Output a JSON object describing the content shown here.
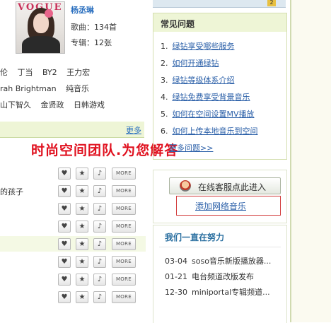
{
  "artist": {
    "name": "杨丞琳",
    "songs": "歌曲：134首",
    "albums": "专辑：12张",
    "photo_magazine_text": "VOGUE"
  },
  "related_artists": [
    [
      "伦",
      "丁当",
      "BY2",
      "王力宏"
    ],
    [
      "rah Brightman",
      "纯音乐"
    ],
    [
      "山下智久",
      "金贤政",
      "日韩游戏"
    ]
  ],
  "more_link": "更多",
  "overlay_text": "时尚空间团队.为您解答",
  "songs": [
    {
      "title": ""
    },
    {
      "title": "的孩子"
    },
    {
      "title": ""
    },
    {
      "title": ""
    },
    {
      "title": ""
    },
    {
      "title": ""
    },
    {
      "title": ""
    },
    {
      "title": ""
    }
  ],
  "song_more_label": "MORE",
  "faq": {
    "title": "常见问题",
    "items": [
      {
        "num": "1.",
        "text": "绿钻享受哪些服务"
      },
      {
        "num": "2.",
        "text": "如何开通绿钻"
      },
      {
        "num": "3.",
        "text": "绿钻等级体系介绍"
      },
      {
        "num": "4.",
        "text": "绿钻免费享受背景音乐"
      },
      {
        "num": "5.",
        "text": "如何在空间设置MV播放"
      },
      {
        "num": "6.",
        "text": "如何上传本地音乐到空间"
      }
    ],
    "more_text": "更多问题>>"
  },
  "customer_service": {
    "button_label": "在线客服点此进入",
    "add_music_link": "添加网络音乐"
  },
  "news": {
    "title": "我们一直在努力",
    "items": [
      {
        "date": "03-04",
        "text": "soso音乐新版播放器..."
      },
      {
        "date": "01-21",
        "text": "电台频道改版发布"
      },
      {
        "date": "12-30",
        "text": "miniportal专辑频道..."
      }
    ]
  },
  "colors": {
    "accent_green_bg": "#eef5d6",
    "link_blue": "#2a5fa8",
    "overlay_red": "#e0101e"
  }
}
